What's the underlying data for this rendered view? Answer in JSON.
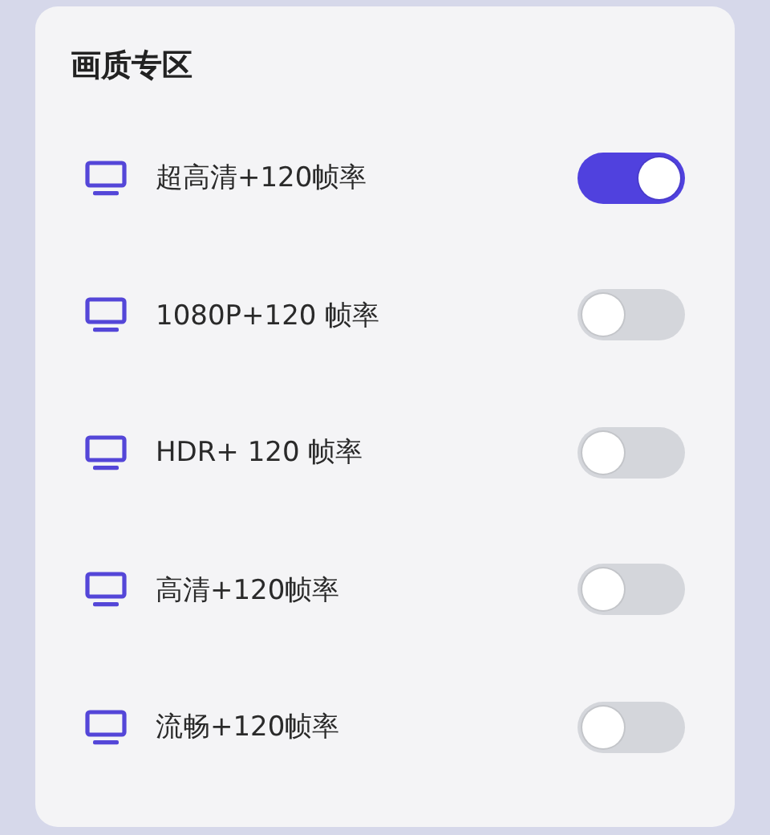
{
  "section": {
    "title": "画质专区"
  },
  "options": [
    {
      "label": "超高清+120帧率",
      "on": true
    },
    {
      "label": "1080P+120 帧率",
      "on": false
    },
    {
      "label": "HDR+ 120 帧率",
      "on": false
    },
    {
      "label": "高清+120帧率",
      "on": false
    },
    {
      "label": "流畅+120帧率",
      "on": false
    }
  ]
}
